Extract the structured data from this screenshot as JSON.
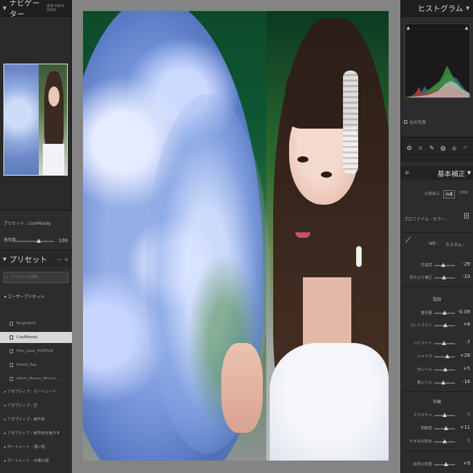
{
  "left_panel": {
    "navigator": {
      "title": "ナビゲーター",
      "zoom_labels": "全体 100% 200%"
    },
    "preset_info": {
      "preset_label": "プリセット : CoolMoody",
      "amount_label": "適用量",
      "amount_value": "100",
      "amount_level": 0.6
    },
    "presets": {
      "title": "プリセット",
      "add_label": "－ ＋",
      "search_placeholder": "プリセットを検索",
      "user_group": "ユーザープリセット",
      "items": [
        "BrightSoft",
        "CoolMoody",
        "Film_Look_FUJIFILM",
        "Pastel_Pop",
        "Warm_Brown_Mocha"
      ],
      "selected_index": 1,
      "groups": [
        "アダプティブ : ポートレート",
        "アダプティブ : 空",
        "アダプティブ : 被写体",
        "アダプティブ : 被写体を抜かす",
        "ポートレート : 濃い肌",
        "ポートレート : 中間の肌"
      ]
    }
  },
  "right_panel": {
    "histogram": {
      "title": "ヒストグラム",
      "original_photo_label": "元の写真"
    },
    "basic": {
      "title": "基本補正",
      "treatments": [
        "白黒表示",
        "白黒",
        "HDR"
      ],
      "profile_label": "プロファイル : カラー :",
      "wb_label": "WB :",
      "wb_value": "カスタム :",
      "color_rows": [
        {
          "label": "色温度",
          "value": "-29",
          "level": 0.42
        },
        {
          "label": "色かぶり補正",
          "value": "-10",
          "level": 0.46
        }
      ],
      "tone_title": "階調",
      "tone_rows": [
        {
          "label": "露光量",
          "value": "-0.09",
          "level": 0.49
        },
        {
          "label": "コントラスト",
          "value": "+6",
          "level": 0.53
        }
      ],
      "tone_rows2": [
        {
          "label": "ハイライト",
          "value": "-7",
          "level": 0.47
        },
        {
          "label": "シャドウ",
          "value": "+26",
          "level": 0.62
        },
        {
          "label": "白レベル",
          "value": "+5",
          "level": 0.53
        },
        {
          "label": "黒レベル",
          "value": "-16",
          "level": 0.42
        }
      ],
      "presence_title": "外観",
      "presence_rows": [
        {
          "label": "テクスチャ",
          "value": "0",
          "level": 0.5
        },
        {
          "label": "明瞭度",
          "value": "+11",
          "level": 0.56
        },
        {
          "label": "かすみの除去",
          "value": "0",
          "level": 0.5
        }
      ],
      "vibrance_row": {
        "label": "自然な彩度",
        "value": "+9",
        "level": 0.55
      }
    }
  },
  "colors": {
    "selected_item_bg": "#d8d8d8",
    "panel_bg": "#2c2c2c",
    "canvas_bg": "#848484"
  }
}
